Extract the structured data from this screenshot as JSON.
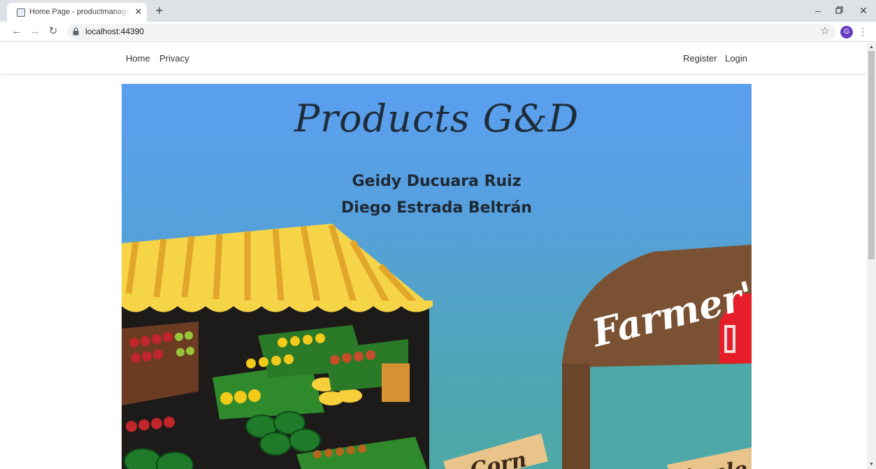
{
  "browser": {
    "tab_title": "Home Page - productmanagement",
    "tab_close": "✕",
    "new_tab": "+",
    "url": "localhost:44390",
    "profile_initial": "G"
  },
  "navbar": {
    "left_links": [
      "Home",
      "Privacy"
    ],
    "right_links": [
      "Register",
      "Login"
    ]
  },
  "hero": {
    "title": "Products G&D",
    "authors": [
      "Geidy Ducuara Ruiz",
      "Diego Estrada Beltrán"
    ],
    "sign_farmers": "Farmer's",
    "sign_corn": "Corn",
    "sign_apple": "Apple"
  },
  "colors": {
    "sky_top": "#5b9ff0",
    "sky_bottom": "#4da8a4",
    "awning_yellow": "#f5d547",
    "sign_brown": "#7a5233"
  }
}
